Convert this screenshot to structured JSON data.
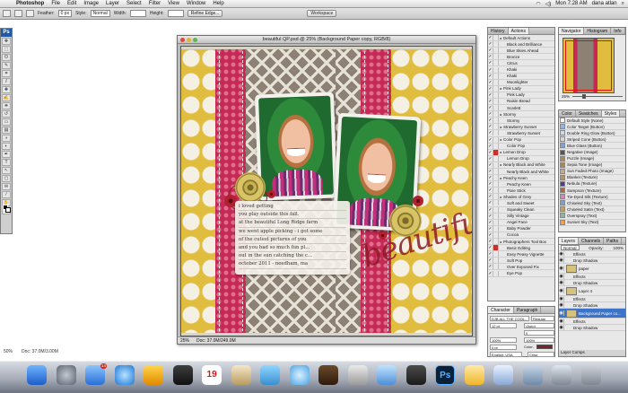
{
  "menubar": {
    "app_name": "Photoshop",
    "items": [
      "File",
      "Edit",
      "Image",
      "Layer",
      "Select",
      "Filter",
      "View",
      "Window",
      "Help"
    ],
    "clock": "Mon 7:28 AM",
    "user": "dana atlan"
  },
  "options": {
    "feather_label": "Feather:",
    "feather_value": "0 px",
    "style_label": "Style:",
    "style_value": "Normal",
    "width_label": "Width:",
    "height_label": "Height:",
    "refine_label": "Refine Edge...",
    "workspace_label": "Workspace"
  },
  "tools": {
    "ps_label": "Ps",
    "items": [
      "move",
      "marquee",
      "lasso",
      "quick-select",
      "crop",
      "slice",
      "heal",
      "brush",
      "stamp",
      "history",
      "eraser",
      "gradient",
      "blur",
      "dodge",
      "pen",
      "type",
      "path-select",
      "shape",
      "notes",
      "eyedropper",
      "hand",
      "zoom"
    ],
    "glyphs": [
      "✥",
      "⬚",
      "ʘ",
      "✎",
      "⌗",
      "⫽",
      "✚",
      "✍",
      "⎈",
      "↺",
      "▭",
      "▤",
      "◖",
      "◐",
      "✒",
      "T",
      "↖",
      "▢",
      "✉",
      "⁄",
      "✋",
      "⌕"
    ]
  },
  "document": {
    "title": "beautiful QP.psd @ 25% (Background Paper copy, RGB/8)",
    "zoom": "25%",
    "doc_info": "Doc: 37.0M/249.0M",
    "journal_lines": [
      "i loved getting",
      "you play outside this fall.",
      "at the beautiful Long Ridge farm",
      "we went apple picking - i got some",
      "of the cutest pictures of you",
      "and you had so much fun pl...",
      "out in the sun catching the c...",
      "october 2011 - needham, ma"
    ],
    "title_script": "beautiful"
  },
  "bottom_status": {
    "zoom": "50%",
    "doc_info": "Doc: 37.0M/3.00M"
  },
  "navigator": {
    "tabs": [
      "Navigator",
      "Histogram",
      "Info"
    ],
    "zoom": "25%"
  },
  "actions": {
    "tabs": [
      "History",
      "Actions"
    ],
    "items": [
      {
        "label": "Default Actions",
        "red": false,
        "folder": true
      },
      {
        "label": "Black and Brilliance",
        "red": false,
        "folder": false
      },
      {
        "label": "Blue Skies Ahead",
        "red": false,
        "folder": false
      },
      {
        "label": "Bronze",
        "red": false,
        "folder": false
      },
      {
        "label": "Citrus",
        "red": false,
        "folder": false
      },
      {
        "label": "Khaki",
        "red": false,
        "folder": false
      },
      {
        "label": "Khaki",
        "red": false,
        "folder": false
      },
      {
        "label": "Moonlighter",
        "red": false,
        "folder": false
      },
      {
        "label": "Pink Lady",
        "red": false,
        "folder": true
      },
      {
        "label": "Pink Lady",
        "red": false,
        "folder": false
      },
      {
        "label": "Raisin Bread",
        "red": false,
        "folder": false
      },
      {
        "label": "Scarlett",
        "red": false,
        "folder": false
      },
      {
        "label": "Stormy",
        "red": false,
        "folder": true
      },
      {
        "label": "Stormy",
        "red": false,
        "folder": false
      },
      {
        "label": "Strawberry Sunset",
        "red": false,
        "folder": true
      },
      {
        "label": "Strawberry Sunset",
        "red": false,
        "folder": false
      },
      {
        "label": "Color Pop",
        "red": false,
        "folder": true
      },
      {
        "label": "Color Pop",
        "red": false,
        "folder": false
      },
      {
        "label": "Lemon Drop",
        "red": true,
        "folder": true
      },
      {
        "label": "Lemon Drop",
        "red": false,
        "folder": false
      },
      {
        "label": "Nearly Black and White",
        "red": false,
        "folder": true
      },
      {
        "label": "Nearly Black and White",
        "red": false,
        "folder": false
      },
      {
        "label": "Peachy Keen",
        "red": false,
        "folder": true
      },
      {
        "label": "Peachy Keen",
        "red": false,
        "folder": false
      },
      {
        "label": "Pixie Stick",
        "red": false,
        "folder": false
      },
      {
        "label": "Shades of Grey",
        "red": false,
        "folder": true
      },
      {
        "label": "Soft and Sweet",
        "red": false,
        "folder": false
      },
      {
        "label": "Squeaky Clean",
        "red": false,
        "folder": false
      },
      {
        "label": "Silly Vintage",
        "red": false,
        "folder": false
      },
      {
        "label": "Angel Face",
        "red": false,
        "folder": false
      },
      {
        "label": "Baby Powder",
        "red": false,
        "folder": false
      },
      {
        "label": "Cocoa",
        "red": false,
        "folder": false
      },
      {
        "label": "Photographers Tool Box",
        "red": false,
        "folder": true
      },
      {
        "label": "Basic Editing",
        "red": true,
        "folder": false
      },
      {
        "label": "Easy Peasy Vignette",
        "red": false,
        "folder": false
      },
      {
        "label": "Soft Pop",
        "red": false,
        "folder": false
      },
      {
        "label": "Over Exposed Fix",
        "red": false,
        "folder": false
      },
      {
        "label": "Eye Pop",
        "red": false,
        "folder": false
      }
    ]
  },
  "styles": {
    "tabs": [
      "Color",
      "Swatches",
      "Styles"
    ],
    "items": [
      "Default Style (None)",
      "Color Target (Button)",
      "Double Ring Glow (Button)",
      "Striped Cone (Button)",
      "Blue Glass (Button)",
      "Negative (Image)",
      "Puzzle (Image)",
      "Sepia Tone (Image)",
      "Sun Faded Photo (Image)",
      "Blanket (Texture)",
      "Nebula (Texture)",
      "Sampson (Texture)",
      "Tie-Dyed Silk (Texture)",
      "Chiseled Sky (Text)",
      "Chiseled Satin (Text)",
      "Overspray (Text)",
      "Sunset Sky (Text)"
    ]
  },
  "layers": {
    "tabs": [
      "Layers",
      "Channels",
      "Paths"
    ],
    "blend": "Normal",
    "opacity_label": "Opacity:",
    "opacity": "100%",
    "items": [
      {
        "label": "Effects",
        "indent": true,
        "selected": false
      },
      {
        "label": "Drop Shadow",
        "indent": true,
        "selected": false
      },
      {
        "label": "paper",
        "indent": false,
        "selected": false
      },
      {
        "label": "Effects",
        "indent": true,
        "selected": false
      },
      {
        "label": "Drop Shadow",
        "indent": true,
        "selected": false
      },
      {
        "label": "Layer 4",
        "indent": false,
        "selected": false
      },
      {
        "label": "Effects",
        "indent": true,
        "selected": false
      },
      {
        "label": "Drop Shadow",
        "indent": true,
        "selected": false
      },
      {
        "label": "Background Paper co...",
        "indent": false,
        "selected": true
      },
      {
        "label": "Effects",
        "indent": true,
        "selected": false
      },
      {
        "label": "Drop Shadow",
        "indent": true,
        "selected": false
      }
    ],
    "comps_label": "Layer Comps"
  },
  "character": {
    "tabs": [
      "Character",
      "Paragraph"
    ],
    "font": "DJB ALL THE COOL...",
    "style": "Regular",
    "size": "12 pt",
    "leading": "(Auto)",
    "tracking": "0",
    "scale_v": "100%",
    "scale_h": "100%",
    "baseline": "0 pt",
    "color_label": "Color:",
    "language": "English: USA",
    "aa": "Crisp"
  },
  "colors": {
    "accent": "#3b74c9",
    "ps_blue": "#1e5aa8",
    "mustard": "#e1bd3f",
    "raspberry": "#c42a55",
    "taupe": "#8d8075"
  },
  "dock": {
    "mail_badge": "14",
    "calendar_day": "19",
    "ps_label": "Ps"
  }
}
